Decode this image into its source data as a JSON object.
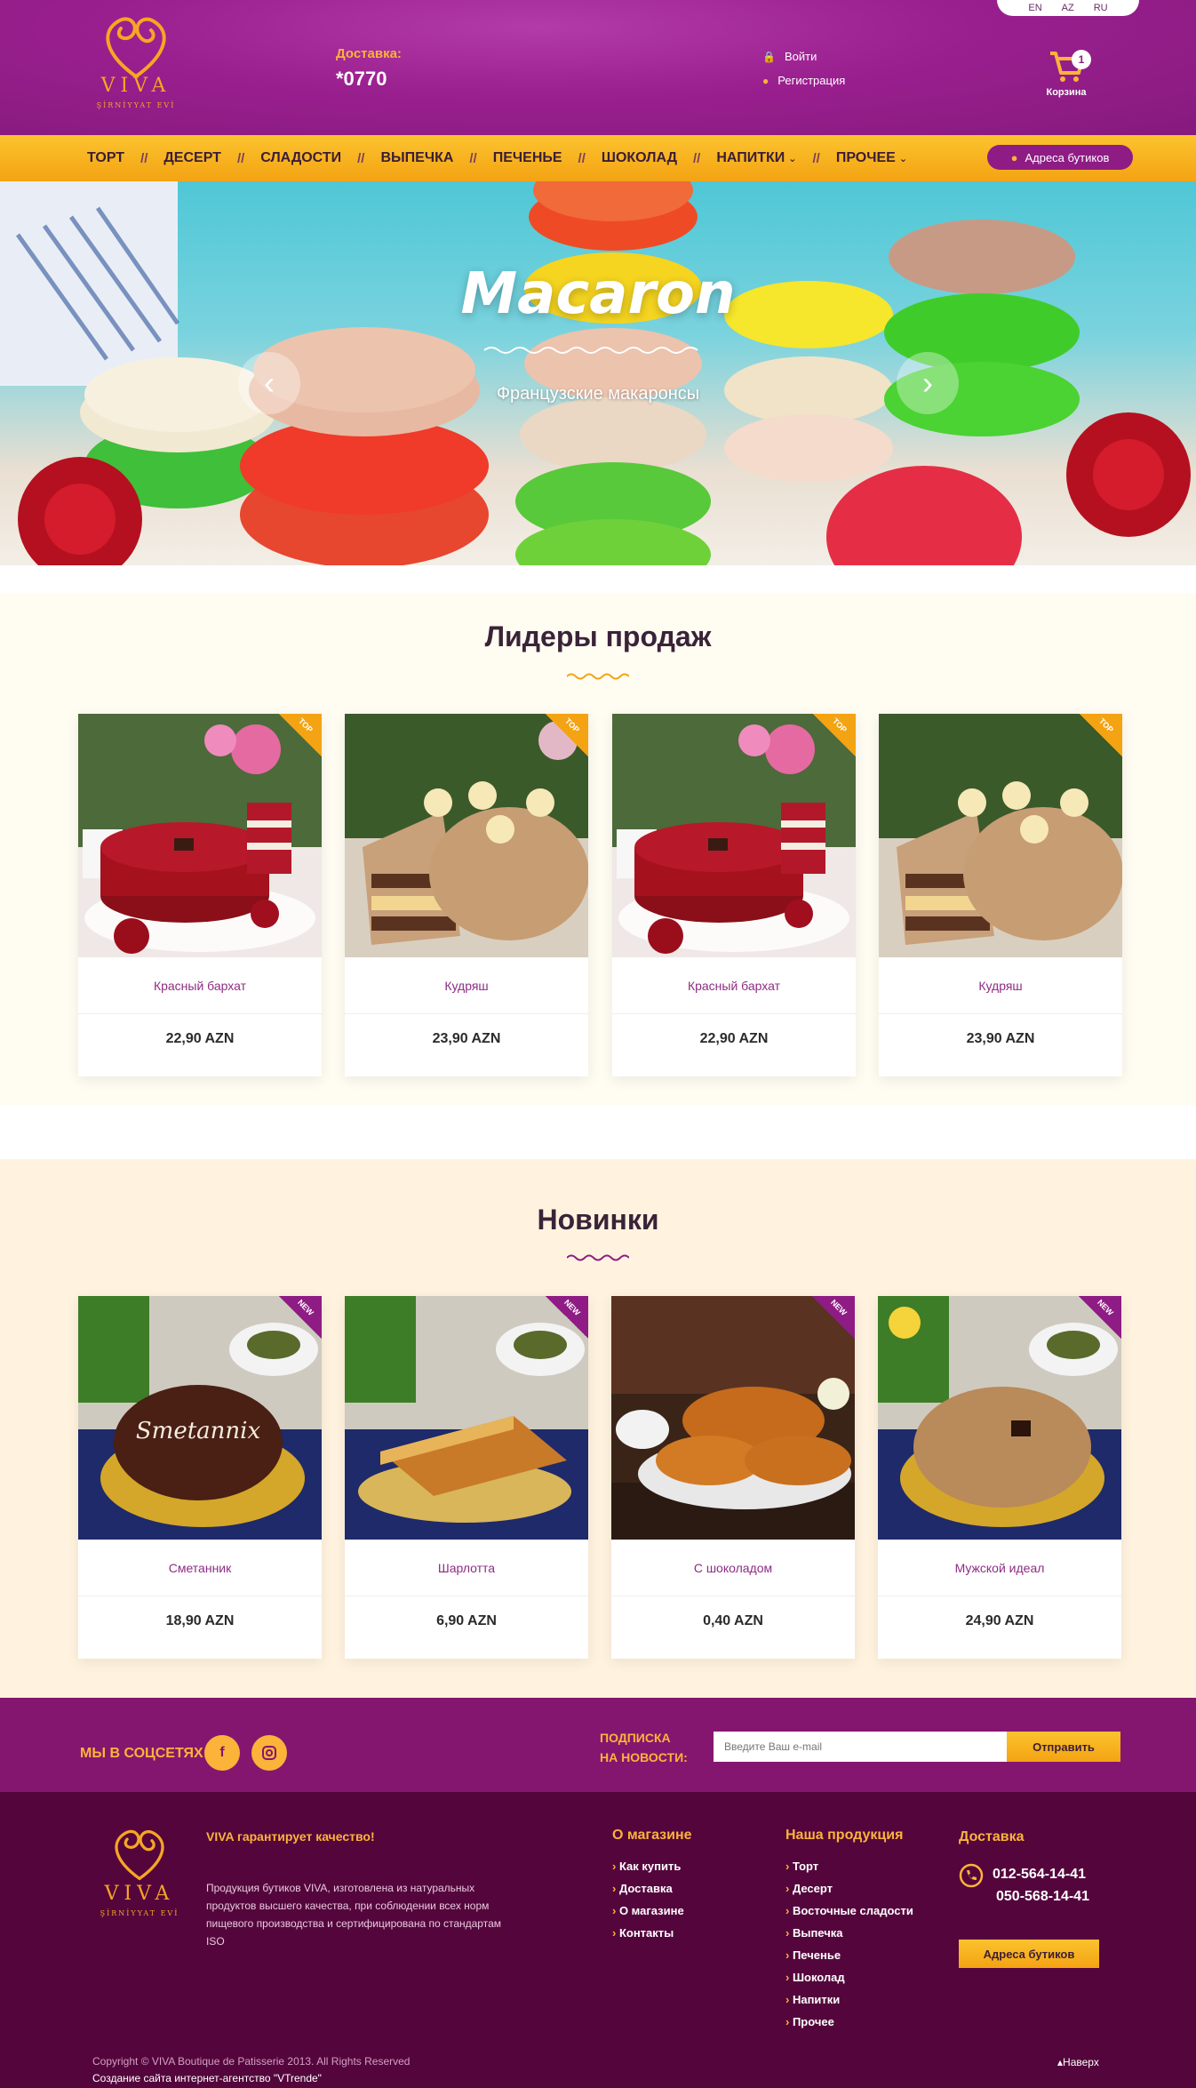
{
  "header": {
    "languages": [
      "EN",
      "AZ",
      "RU"
    ],
    "logo_word": "VIVA",
    "logo_sub": "ŞİRNİYYAT EVİ",
    "delivery_label": "Доставка:",
    "delivery_number": "*0770",
    "login": "Войти",
    "register": "Регистрация",
    "cart_count": "1",
    "cart_label": "Корзина"
  },
  "nav": {
    "items": [
      "ТОРТ",
      "ДЕСЕРТ",
      "СЛАДОСТИ",
      "ВЫПЕЧКА",
      "ПЕЧЕНЬЕ",
      "ШОКОЛАД",
      "НАПИТКИ",
      "ПРОЧЕЕ"
    ],
    "boutique_button": "Адреса бутиков"
  },
  "hero": {
    "title": "Macaron",
    "subtitle": "Французские макаронсы"
  },
  "bestsellers": {
    "title": "Лидеры продаж",
    "badge": "TOP",
    "products": [
      {
        "name": "Красный бархат",
        "price": "22,90 AZN"
      },
      {
        "name": "Кудряш",
        "price": "23,90 AZN"
      },
      {
        "name": "Красный бархат",
        "price": "22,90 AZN"
      },
      {
        "name": "Кудряш",
        "price": "23,90 AZN"
      }
    ]
  },
  "novelties": {
    "title": "Новинки",
    "badge": "NEW",
    "products": [
      {
        "name": "Сметанник",
        "price": "18,90 AZN",
        "inscription": "Smetannix"
      },
      {
        "name": "Шарлотта",
        "price": "6,90 AZN"
      },
      {
        "name": "С шоколадом",
        "price": "0,40 AZN"
      },
      {
        "name": "Мужской идеал",
        "price": "24,90 AZN"
      }
    ]
  },
  "subscribe": {
    "social_label": "МЫ В СОЦСЕТЯХ:",
    "news_label_1": "ПОДПИСКА",
    "news_label_2": "НА НОВОСТИ:",
    "email_placeholder": "Введите Ваш e-mail",
    "send": "Отправить"
  },
  "footer": {
    "quality_title": "VIVA гарантирует качество!",
    "quality_text": "Продукция бутиков VIVA, изготовлена из натуральных продуктов высшего качества, при соблюдении всех норм пищевого производства и сертифицирована по стандартам ISO",
    "about_title": "О магазине",
    "about_links": [
      "Как купить",
      "Доставка",
      "О магазине",
      "Контакты"
    ],
    "products_title": "Наша продукция",
    "products_links": [
      "Торт",
      "Десерт",
      "Восточные сладости",
      "Выпечка",
      "Печенье",
      "Шоколад",
      "Напитки",
      "Прочее"
    ],
    "delivery_title": "Доставка",
    "phone1": "012-564-14-41",
    "phone2": "050-568-14-41",
    "boutique_button": "Адреса бутиков",
    "copyright": "Copyright © VIVA Boutique de Patisserie 2013. All Rights Reserved",
    "credit": "Создание сайта интернет-агентство \"VTrende\"",
    "back_to_top": "Наверх"
  },
  "colors": {
    "purple": "#8e1c84",
    "gold": "#fbb33a",
    "footer": "#54063c"
  }
}
